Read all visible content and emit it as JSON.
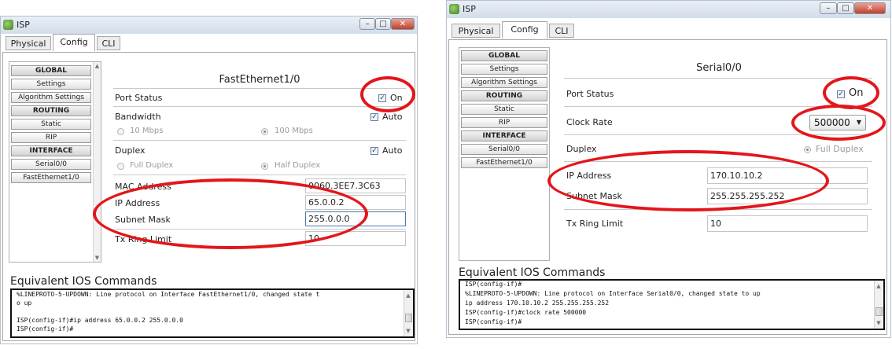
{
  "left": {
    "window_title": "ISP",
    "tabs": [
      "Physical",
      "Config",
      "CLI"
    ],
    "sidebar": [
      "GLOBAL",
      "Settings",
      "Algorithm Settings",
      "ROUTING",
      "Static",
      "RIP",
      "INTERFACE",
      "Serial0/0",
      "FastEthernet1/0"
    ],
    "section_title": "FastEthernet1/0",
    "port_status_label": "Port Status",
    "port_status_value": "On",
    "bandwidth_label": "Bandwidth",
    "bandwidth_auto": "Auto",
    "bw_option_10": "10 Mbps",
    "bw_option_100": "100 Mbps",
    "duplex_label": "Duplex",
    "duplex_auto": "Auto",
    "duplex_full": "Full Duplex",
    "duplex_half": "Half Duplex",
    "mac_label": "MAC Address",
    "mac_value": "0060.3EE7.3C63",
    "ip_label": "IP Address",
    "ip_value": "65.0.0.2",
    "mask_label": "Subnet Mask",
    "mask_value": "255.0.0.0",
    "tx_label": "Tx Ring Limit",
    "tx_value": "10",
    "ios_title": "Equivalent IOS Commands",
    "console_lines": [
      "%LINEPROTO-5-UPDOWN: Line protocol on Interface FastEthernet1/0, changed state t",
      "o up",
      "",
      "ISP(config-if)#ip address 65.0.0.2 255.0.0.0",
      "ISP(config-if)#"
    ]
  },
  "right": {
    "window_title": "ISP",
    "tabs": [
      "Physical",
      "Config",
      "CLI"
    ],
    "sidebar": [
      "GLOBAL",
      "Settings",
      "Algorithm Settings",
      "ROUTING",
      "Static",
      "RIP",
      "INTERFACE",
      "Serial0/0",
      "FastEthernet1/0"
    ],
    "section_title": "Serial0/0",
    "port_status_label": "Port Status",
    "port_status_value": "On",
    "clock_label": "Clock Rate",
    "clock_value": "500000",
    "duplex_label": "Duplex",
    "duplex_full": "Full Duplex",
    "ip_label": "IP Address",
    "ip_value": "170.10.10.2",
    "mask_label": "Subnet Mask",
    "mask_value": "255.255.255.252",
    "tx_label": "Tx Ring Limit",
    "tx_value": "10",
    "ios_title": "Equivalent IOS Commands",
    "console_lines": [
      "ISP(config-if)#",
      "%LINEPROTO-5-UPDOWN: Line protocol on Interface Serial0/0, changed state to up",
      "ip address 170.10.10.2 255.255.255.252",
      "ISP(config-if)#clock rate 500000",
      "ISP(config-if)#"
    ]
  },
  "colors": {
    "highlight": "#e3161b",
    "titlebar": "#dbe3ee"
  }
}
